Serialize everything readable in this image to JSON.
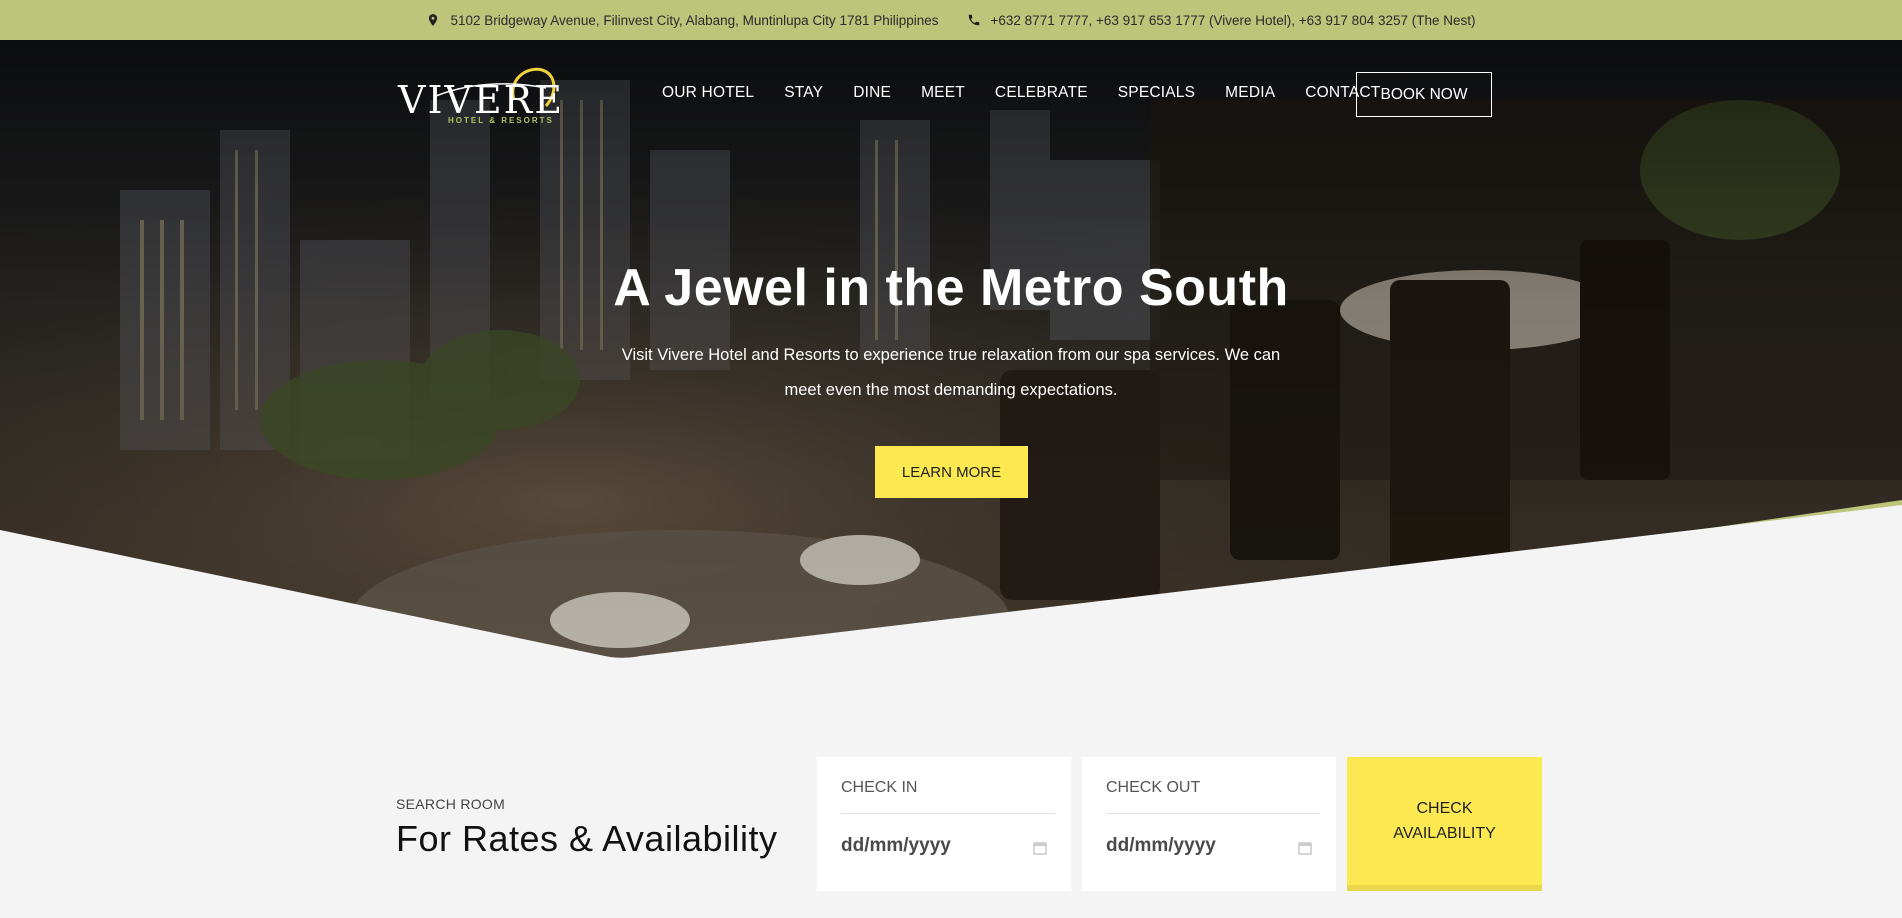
{
  "topbar": {
    "address": "5102 Bridgeway Avenue, Filinvest City, Alabang, Muntinlupa City 1781 Philippines",
    "phones": "+632 8771 7777, +63 917 653 1777 (Vivere Hotel), +63 917 804 3257 (The Nest)",
    "address_icon": "map-pin-icon",
    "phone_icon": "phone-icon"
  },
  "logo": {
    "name": "VIVERE",
    "tagline": "HOTEL & RESORTS"
  },
  "nav": {
    "items": [
      "OUR HOTEL",
      "STAY",
      "DINE",
      "MEET",
      "CELEBRATE",
      "SPECIALS",
      "MEDIA",
      "CONTACT"
    ],
    "book_now": "BOOK NOW"
  },
  "hero": {
    "title": "A Jewel in the Metro South",
    "description": "Visit Vivere Hotel and Resorts to experience true relaxation from our spa services. We can meet even the most demanding expectations.",
    "cta": "LEARN MORE"
  },
  "search": {
    "kicker": "SEARCH ROOM",
    "heading": "For Rates & Availability",
    "check_in_label": "CHECK IN",
    "check_out_label": "CHECK OUT",
    "date_placeholder": "dd/mm/yyyy",
    "calendar_icon": "calendar-icon",
    "button": "CHECK AVAILABILITY"
  },
  "colors": {
    "accent_green": "#bcc57a",
    "accent_yellow": "#fce951",
    "background": "#f4f4f4"
  }
}
